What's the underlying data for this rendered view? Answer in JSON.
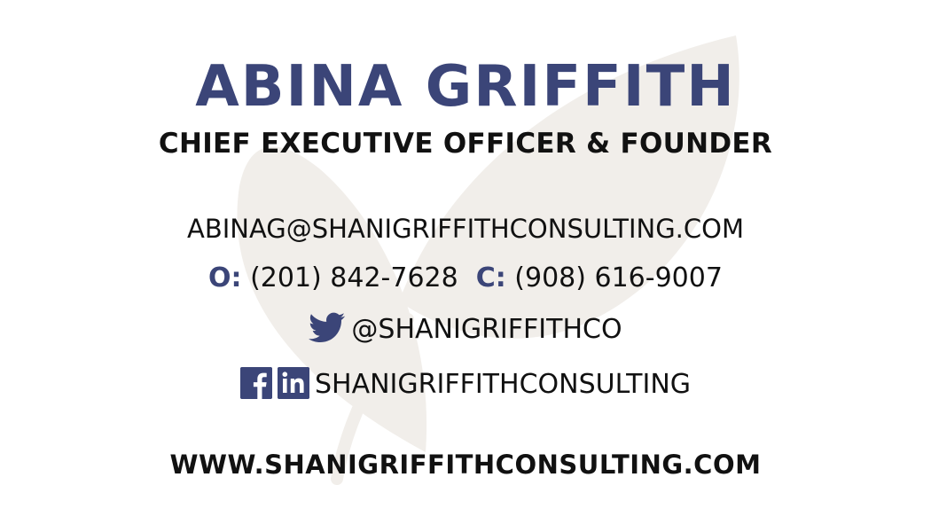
{
  "card": {
    "name": "ABINA GRIFFITH",
    "title": "CHIEF EXECUTIVE OFFICER & FOUNDER",
    "email": "ABINAG@SHANIGRIFFITHCONSULTING.COM",
    "office_label": "O:",
    "office_phone": "(201) 842-7628",
    "cell_label": "C:",
    "cell_phone": "(908) 616-9007",
    "twitter_handle": "@SHANIGRIFFITHCO",
    "social_handle": "SHANIGRIFFITHCONSULTING",
    "website": "WWW.SHANIGRIFFITHCONSULTING.COM"
  },
  "icons": {
    "twitter": "twitter-icon",
    "facebook": "facebook-icon",
    "linkedin": "linkedin-icon",
    "watermark": "leaf-icon"
  },
  "colors": {
    "accent": "#3b4578",
    "text": "#111111",
    "watermark": "#f1eeea",
    "background": "#ffffff"
  }
}
